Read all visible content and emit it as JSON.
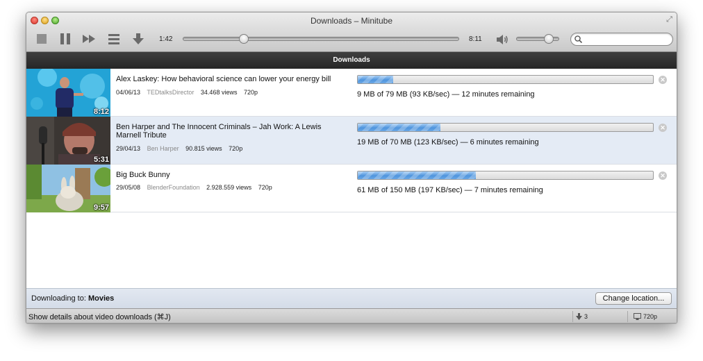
{
  "window": {
    "title": "Downloads – Minitube"
  },
  "toolbar": {
    "elapsed": "1:42",
    "total": "8:11",
    "seek_fraction": 0.21,
    "volume_fraction": 0.85,
    "search_placeholder": ""
  },
  "section_header": "Downloads",
  "downloads": [
    {
      "title": "Alex Laskey: How behavioral science can lower your energy bill",
      "date": "04/06/13",
      "author": "TEDtalksDirector",
      "views": "34.468 views",
      "quality": "720p",
      "duration": "8:12",
      "progress": 0.12,
      "status": "9 MB of 79 MB (93 KB/sec) — 12 minutes remaining",
      "selected": false
    },
    {
      "title": "Ben Harper and The Innocent Criminals – Jah Work: A Lewis Marnell Tribute",
      "date": "29/04/13",
      "author": "Ben Harper",
      "views": "90.815 views",
      "quality": "720p",
      "duration": "5:31",
      "progress": 0.28,
      "status": "19 MB of 70 MB (123 KB/sec) — 6 minutes remaining",
      "selected": true
    },
    {
      "title": "Big Buck Bunny",
      "date": "29/05/08",
      "author": "BlenderFoundation",
      "views": "2.928.559 views",
      "quality": "720p",
      "duration": "9:57",
      "progress": 0.4,
      "status": "61 MB of 150 MB (197 KB/sec) — 7 minutes remaining",
      "selected": false
    }
  ],
  "footer": {
    "downloading_to_label": "Downloading to:",
    "folder": "Movies",
    "change_location": "Change location..."
  },
  "statusbar": {
    "message": "Show details about video downloads (⌘J)",
    "downloads_count": "3 Download(s)",
    "quality": "720p"
  },
  "colors": {
    "progress_blue": "#4f95dd",
    "selected_row": "#e4ebf5",
    "header_dark": "#2e2e2e"
  }
}
